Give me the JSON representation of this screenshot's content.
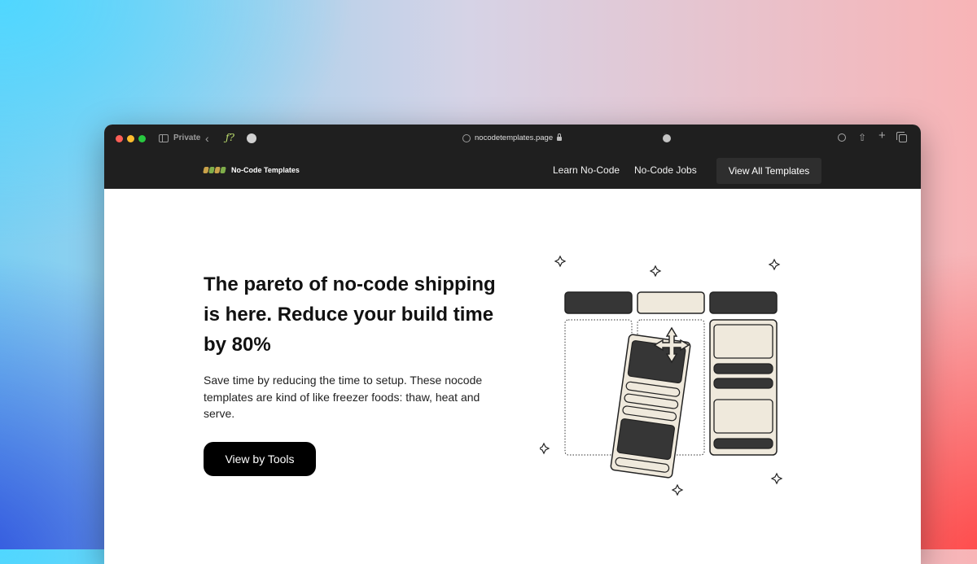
{
  "browser": {
    "private_label": "Private",
    "url": "nocodetemplates.page",
    "icons": [
      "sidebar-icon",
      "back-icon",
      "extension-icon",
      "profile-icon",
      "globe-icon",
      "lock-icon",
      "more-icon",
      "download-icon",
      "share-icon",
      "new-tab-icon",
      "tabs-icon"
    ]
  },
  "nav": {
    "logo_text": "No-Code Templates",
    "links": [
      "Learn No-Code",
      "No-Code Jobs"
    ],
    "cta": "View All Templates"
  },
  "hero": {
    "title": "The pareto of no-code shipping is here. Reduce your build time by 80%",
    "subtitle": "Save time by reducing the time to setup. These nocode templates are kind of like freezer foods: thaw, heat and serve.",
    "cta": "View by Tools"
  },
  "colors": {
    "dark": "#1f1f1f",
    "cream": "#efe9dc",
    "card_dark": "#363636",
    "button": "#000000"
  }
}
